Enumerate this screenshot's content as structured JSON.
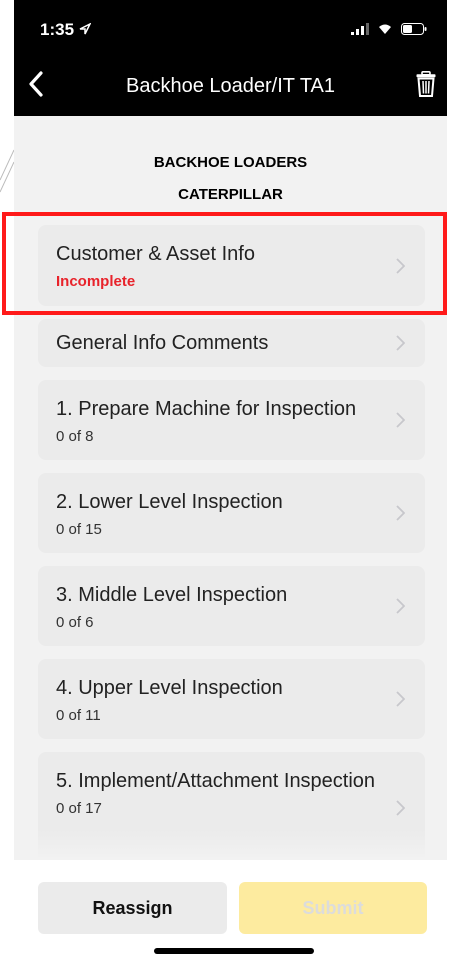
{
  "status_bar": {
    "time": "1:35"
  },
  "nav": {
    "title": "Backhoe Loader/IT TA1"
  },
  "header": {
    "line1": "BACKHOE LOADERS",
    "line2": "CATERPILLAR"
  },
  "sections": [
    {
      "title": "Customer & Asset Info",
      "subtitle": "Incomplete",
      "status": "incomplete"
    },
    {
      "title": "General Info Comments",
      "subtitle": ""
    },
    {
      "title": "1. Prepare Machine for Inspection",
      "subtitle": "0 of 8"
    },
    {
      "title": "2. Lower Level Inspection",
      "subtitle": "0 of 15"
    },
    {
      "title": "3. Middle Level Inspection",
      "subtitle": "0 of 6"
    },
    {
      "title": "4. Upper Level Inspection",
      "subtitle": "0 of 11"
    },
    {
      "title": "5. Implement/Attachment Inspection",
      "subtitle": "0 of 17"
    }
  ],
  "buttons": {
    "reassign": "Reassign",
    "submit": "Submit"
  },
  "colors": {
    "incomplete": "#e8232b",
    "highlight_border": "#ff1a1a",
    "submit_bg": "#fdeb9f"
  }
}
